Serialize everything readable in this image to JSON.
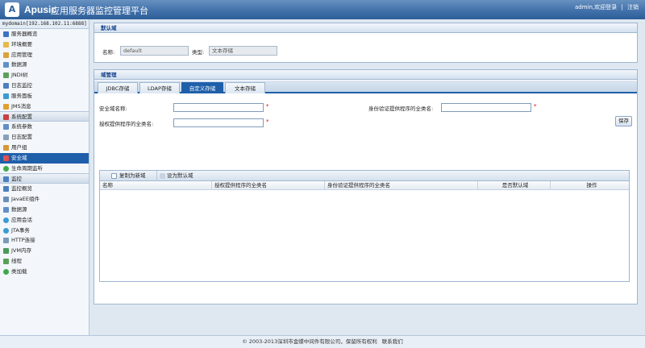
{
  "header": {
    "logo_letter": "A",
    "brand": "Apusic",
    "title": "应用服务器监控管理平台",
    "user": "admin,",
    "welcome": "欢迎登录",
    "separator": "|",
    "logout": "注销"
  },
  "sidebar": {
    "domain": "mydomain[192.168.102.11:6888]",
    "items_top": [
      {
        "label": "服务器概览",
        "icon": "server-icon"
      },
      {
        "label": "环境概要",
        "icon": "environment-icon"
      },
      {
        "label": "应用管理",
        "icon": "application-icon"
      },
      {
        "label": "数据源",
        "icon": "datasource-icon"
      },
      {
        "label": "JNDI树",
        "icon": "jndi-icon"
      },
      {
        "label": "日志监控",
        "icon": "log-monitor-icon"
      },
      {
        "label": "服务面板",
        "icon": "service-panel-icon"
      },
      {
        "label": "JMS消息",
        "icon": "jms-icon"
      }
    ],
    "group_config": "系统配置",
    "items_config": [
      {
        "label": "系统参数",
        "icon": "params-icon"
      },
      {
        "label": "日志配置",
        "icon": "log-config-icon"
      },
      {
        "label": "用户组",
        "icon": "user-group-icon"
      },
      {
        "label": "安全域",
        "icon": "security-icon"
      },
      {
        "label": "生命周期监听",
        "icon": "lifecycle-icon"
      }
    ],
    "group_monitor": "监控",
    "items_monitor": [
      {
        "label": "监控概览",
        "icon": "monitor-overview-icon"
      },
      {
        "label": "JavaEE组件",
        "icon": "javaee-icon"
      },
      {
        "label": "数据源",
        "icon": "datasource-icon"
      },
      {
        "label": "应用会话",
        "icon": "session-icon"
      },
      {
        "label": "JTA事务",
        "icon": "jta-icon"
      },
      {
        "label": "HTTP连接",
        "icon": "http-icon"
      },
      {
        "label": "JVM内存",
        "icon": "jvm-icon"
      },
      {
        "label": "线程",
        "icon": "thread-icon"
      },
      {
        "label": "类加载",
        "icon": "classloader-icon"
      }
    ]
  },
  "default_domain": {
    "title": "默认域",
    "name_label": "名称:",
    "name_value": "default",
    "type_label": "类型:",
    "type_value": "文本存储"
  },
  "domain_mgmt": {
    "title": "域管理",
    "tabs": [
      "JDBC存储",
      "LDAP存储",
      "自定义存储",
      "文本存储"
    ],
    "active_tab": 2,
    "fields": {
      "name_label": "安全域名称:",
      "auth_label": "身份验证提供程序的全类名:",
      "authz_label": "授权提供程序的全类名:",
      "required_mark": "*"
    },
    "save": "保存",
    "toolbar": {
      "copy": "复制为新域",
      "set_default": "设为默认域"
    },
    "columns": [
      "名称",
      "授权提供程序的全类名",
      "身份验证提供程序的全类名",
      "是否默认域",
      "操作"
    ]
  },
  "footer": {
    "text": "© 2003-2013深圳市金蝶中间件有限公司，保留所有权利",
    "contact": "联系我们"
  },
  "colors": {
    "header": "#3f6fa8",
    "accent": "#1f5faa",
    "required": "#dd0000",
    "background": "#dfe8f1"
  }
}
